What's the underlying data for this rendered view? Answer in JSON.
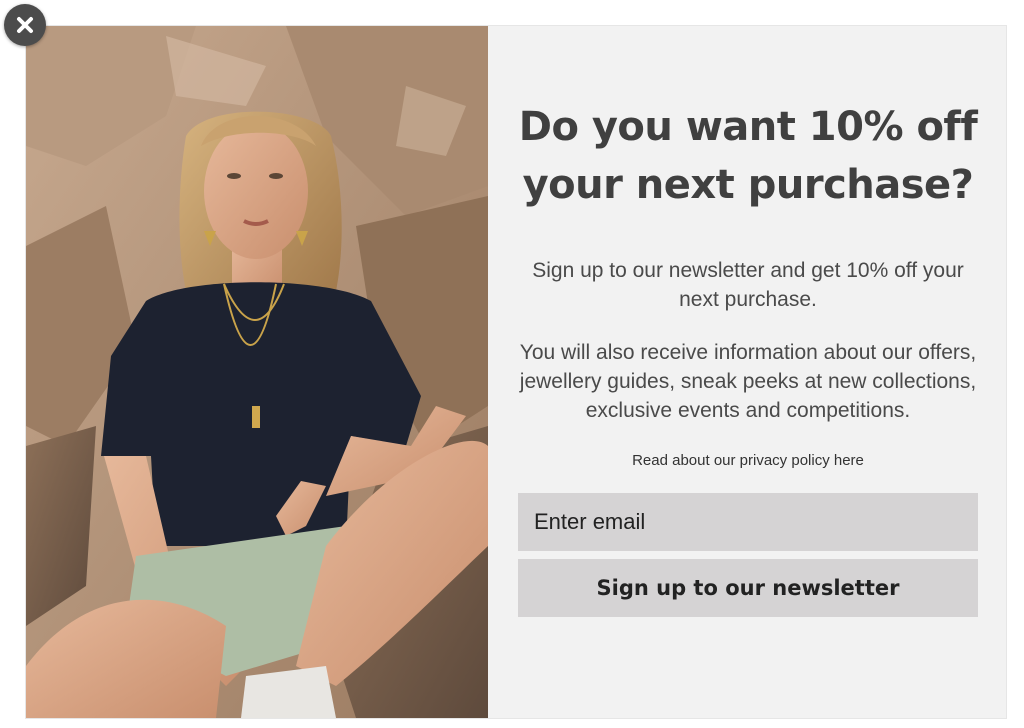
{
  "popup": {
    "headline": "Do you want 10% off your next purchase?",
    "intro": "Sign up to our newsletter and get 10% off your next purchase.",
    "details": "You will also receive information about our offers, jewellery guides, sneak peeks at new collections, exclusive events and competitions.",
    "privacy_link": "Read about our privacy policy here",
    "email_placeholder": "Enter email",
    "email_value": "",
    "submit_label": "Sign up to our newsletter"
  },
  "icons": {
    "close": "close-icon"
  },
  "colors": {
    "panel_background": "#f2f2f2",
    "headline": "#404040",
    "field_background": "#d5d3d4",
    "close_button": "#4c4c4c"
  }
}
